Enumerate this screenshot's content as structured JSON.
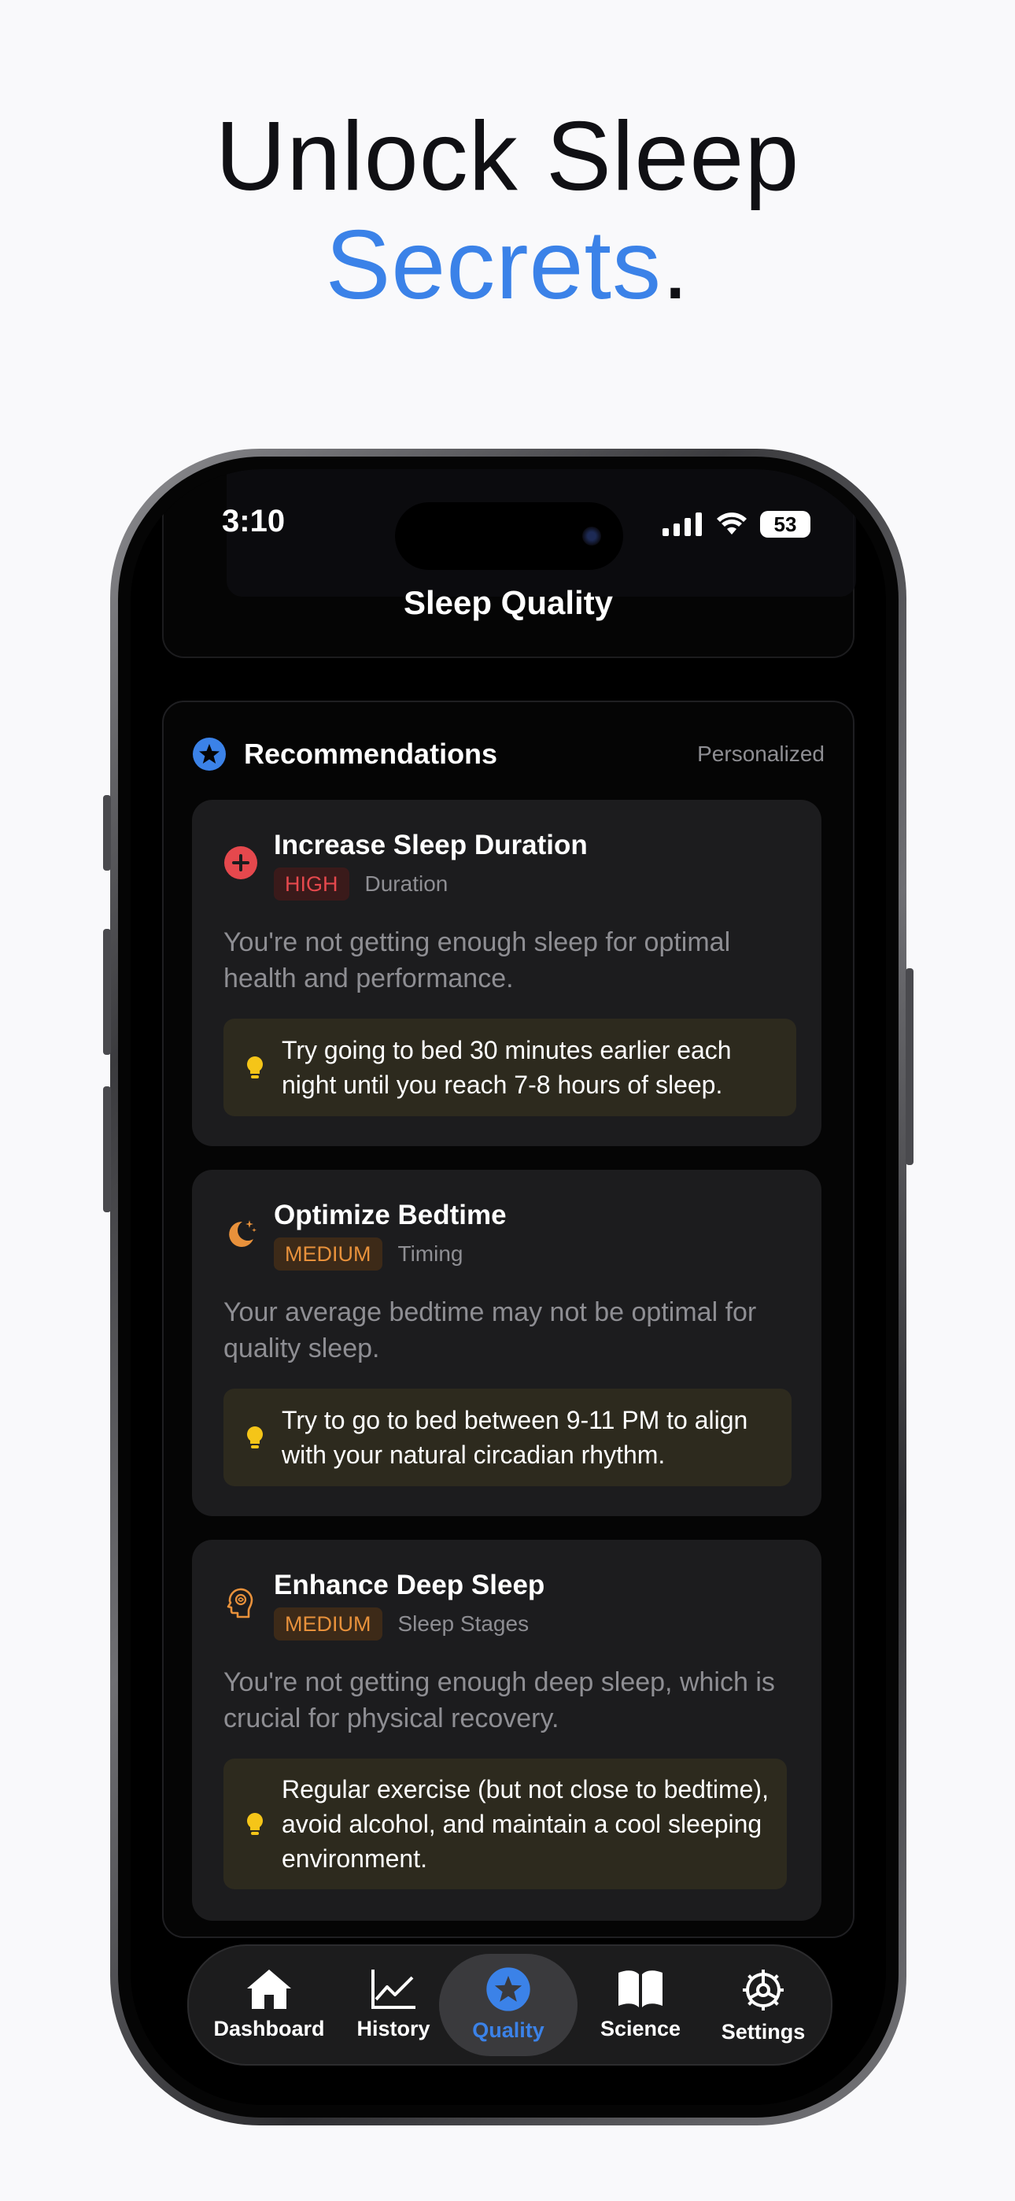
{
  "headline": {
    "line1": "Unlock Sleep",
    "line2_accent": "Secrets",
    "line2_end": "."
  },
  "status_bar": {
    "time": "3:10",
    "battery": "53"
  },
  "nav": {
    "title": "Sleep Quality"
  },
  "recommendations": {
    "title": "Recommendations",
    "tag": "Personalized",
    "items": [
      {
        "title": "Increase Sleep Duration",
        "priority": "HIGH",
        "category": "Duration",
        "description": "You're not getting enough sleep for optimal health and performance.",
        "tip": "Try going to bed 30 minutes earlier each night until you reach 7-8 hours of sleep.",
        "icon": "plus-circle-icon"
      },
      {
        "title": "Optimize Bedtime",
        "priority": "MEDIUM",
        "category": "Timing",
        "description": "Your average bedtime may not be optimal for quality sleep.",
        "tip": "Try to go to bed between 9-11 PM to align with your natural circadian rhythm.",
        "icon": "moon-stars-icon"
      },
      {
        "title": "Enhance Deep Sleep",
        "priority": "MEDIUM",
        "category": "Sleep Stages",
        "description": "You're not getting enough deep sleep, which is crucial for physical recovery.",
        "tip": "Regular exercise (but not close to bedtime), avoid alcohol, and maintain a cool sleeping environment.",
        "icon": "brain-head-icon"
      }
    ]
  },
  "tabbar": {
    "tabs": [
      {
        "label": "Dashboard",
        "icon": "house-icon"
      },
      {
        "label": "History",
        "icon": "chart-line-icon"
      },
      {
        "label": "Quality",
        "icon": "star-circle-icon",
        "active": true
      },
      {
        "label": "Science",
        "icon": "book-icon"
      },
      {
        "label": "Settings",
        "icon": "gear-icon"
      }
    ]
  },
  "colors": {
    "accent": "#3b82e8",
    "high": "#e5484d",
    "medium": "#e8913b",
    "tip_bulb": "#f5c518"
  }
}
